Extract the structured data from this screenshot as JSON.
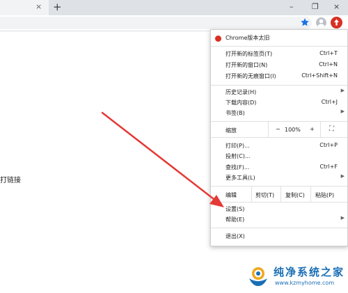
{
  "tabstrip": {
    "close_glyph": "×",
    "new_tab_glyph": "+",
    "minimize_glyph": "–",
    "restore_glyph": "❐",
    "window_close_glyph": "×"
  },
  "page": {
    "partial_text": "打链接"
  },
  "menu": {
    "update_label": "Chrome版本太旧",
    "new_tab": {
      "label": "打开新的标签页(T)",
      "shortcut": "Ctrl+T"
    },
    "new_window": {
      "label": "打开新的窗口(N)",
      "shortcut": "Ctrl+N"
    },
    "incognito": {
      "label": "打开新的无痕窗口(I)",
      "shortcut": "Ctrl+Shift+N"
    },
    "history": {
      "label": "历史记录(H)"
    },
    "downloads": {
      "label": "下载内容(D)",
      "shortcut": "Ctrl+J"
    },
    "bookmarks": {
      "label": "书签(B)"
    },
    "zoom": {
      "label": "缩放",
      "minus": "−",
      "value": "100%",
      "plus": "+",
      "fullscreen": "⛶"
    },
    "print": {
      "label": "打印(P)...",
      "shortcut": "Ctrl+P"
    },
    "cast": {
      "label": "投射(C)..."
    },
    "find": {
      "label": "查找(F)...",
      "shortcut": "Ctrl+F"
    },
    "more_tools": {
      "label": "更多工具(L)"
    },
    "edit": {
      "label": "编辑",
      "cut": "剪切(T)",
      "copy": "复制(C)",
      "paste": "粘贴(P)"
    },
    "settings": {
      "label": "设置(S)"
    },
    "help": {
      "label": "帮助(E)"
    },
    "exit": {
      "label": "退出(X)"
    },
    "submenu_arrow": "▶"
  },
  "watermark": {
    "title": "纯净系统之家",
    "url": "www.kzmyhome.com"
  },
  "colors": {
    "accent_blue": "#1a73e8",
    "update_red": "#d93025",
    "arrow_red": "#e53935",
    "watermark_blue": "#1a6fb5"
  }
}
